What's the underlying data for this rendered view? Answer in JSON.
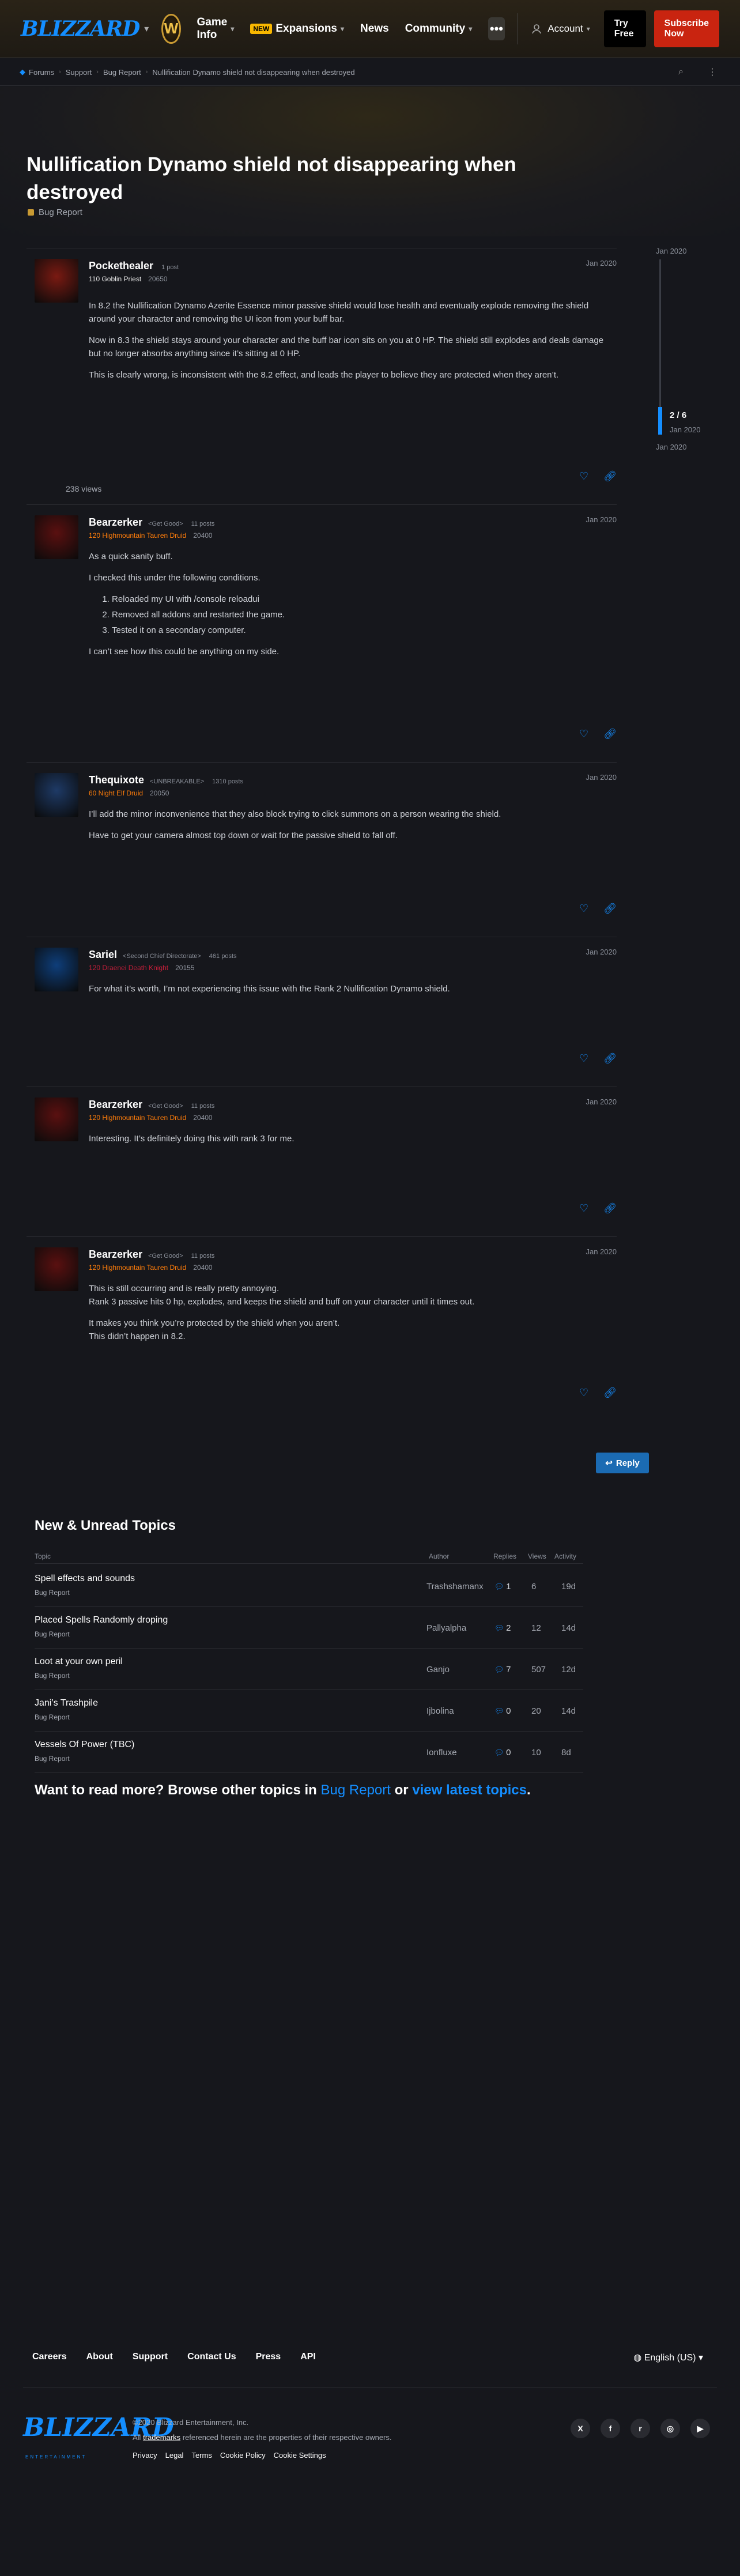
{
  "nav": {
    "logo": "BLIZZARD",
    "game_badge": "W",
    "items": [
      {
        "label": "Game Info",
        "new": ""
      },
      {
        "label": "Expansions",
        "new": "NEW"
      },
      {
        "label": "News",
        "new": ""
      },
      {
        "label": "Community",
        "new": ""
      }
    ],
    "more": "•••",
    "account": "Account",
    "try_free": "Try Free",
    "subscribe": "Subscribe Now"
  },
  "breadcrumb": [
    "Forums",
    "Support",
    "Bug Report",
    "Nullification Dynamo shield not disappearing when destroyed"
  ],
  "topic": {
    "title": "Nullification Dynamo shield not disappearing when destroyed",
    "category": "Bug Report",
    "views": "238 views"
  },
  "timeline": {
    "top_date": "Jan 2020",
    "count": "2 / 6",
    "current_date": "Jan 2020",
    "bottom_date": "Jan 2020"
  },
  "posts": [
    {
      "author": "Pockethealer",
      "title": "",
      "stat": "1 post",
      "info": "110 Goblin Priest",
      "achievement": "20650",
      "date": "Jan 2020",
      "avatar_color": "#7a1a12",
      "paragraphs": [
        "In 8.2 the Nullification Dynamo Azerite Essence minor passive shield would lose health and eventually explode removing the shield around your character and removing the UI icon from your buff bar.",
        "Now in 8.3 the shield stays around your character and the buff bar icon sits on you at 0 HP. The shield still explodes and deals damage but no longer absorbs anything since it’s sitting at 0 HP.",
        "This is clearly wrong, is inconsistent with the 8.2 effect, and leads the player to believe they are protected when they aren’t."
      ],
      "list": []
    },
    {
      "author": "Bearzerker",
      "title": "<Get Good>",
      "stat": "11 posts",
      "info": "120 Highmountain Tauren Druid",
      "achievement": "20400",
      "date": "Jan 2020",
      "avatar_color": "#5a1010",
      "paragraphs": [
        "As a quick sanity buff.",
        "I checked this under the following conditions."
      ],
      "list": [
        "Reloaded my UI with /console reloadui",
        "Removed all addons and restarted the game.",
        "Tested it on a secondary computer."
      ],
      "after": "I can’t see how this could be anything on my side."
    },
    {
      "author": "Thequixote",
      "title": "<UNBREAKABLE>",
      "stat": "1310 posts",
      "info": "60 Night Elf Druid",
      "achievement": "20050",
      "date": "Jan 2020",
      "avatar_color": "#1e3a66",
      "paragraphs": [
        "I’ll add the minor inconvenience that they also block trying to click summons on a person wearing the shield.",
        "Have to get your camera almost top down or wait for the passive shield to fall off."
      ],
      "list": []
    },
    {
      "author": "Sariel",
      "title": "<Second Chief Directorate>",
      "stat": "461 posts",
      "info": "120 Draenei Death Knight",
      "achievement": "20155",
      "date": "Jan 2020",
      "avatar_color": "#0e3e7a",
      "paragraphs": [
        "For what it’s worth, I’m not experiencing this issue with the Rank 2 Nullification Dynamo shield."
      ],
      "list": []
    },
    {
      "author": "Bearzerker",
      "title": "<Get Good>",
      "stat": "11 posts",
      "info": "120 Highmountain Tauren Druid",
      "achievement": "20400",
      "date": "Jan 2020",
      "avatar_color": "#5a1010",
      "paragraphs": [
        "Interesting. It’s definitely doing this with rank 3 for me."
      ],
      "list": []
    },
    {
      "author": "Bearzerker",
      "title": "<Get Good>",
      "stat": "11 posts",
      "info": "120 Highmountain Tauren Druid",
      "achievement": "20400",
      "date": "Jan 2020",
      "avatar_color": "#5a1010",
      "paragraphs": [
        "This is still occurring and is really pretty annoying.\nRank 3 passive hits 0 hp, explodes, and keeps the shield and buff on your character until it times out.",
        "It makes you think you’re protected by the shield when you aren’t.\nThis didn’t happen in 8.2."
      ],
      "list": []
    }
  ],
  "reply_button": "Reply",
  "new_unread": {
    "title": "New & Unread Topics",
    "headers": {
      "topic": "Topic",
      "author": "Author",
      "replies": "Replies",
      "views": "Views",
      "activity": "Activity"
    },
    "rows": [
      {
        "title": "Spell effects and sounds",
        "category": "Bug Report",
        "author": "Trashshamanx",
        "replies": "1",
        "views": "6",
        "activity": "19d"
      },
      {
        "title": "Placed Spells Randomly droping",
        "category": "Bug Report",
        "author": "Pallyalpha",
        "replies": "2",
        "views": "12",
        "activity": "14d"
      },
      {
        "title": "Loot at your own peril",
        "category": "Bug Report",
        "author": "Ganjo",
        "replies": "7",
        "views": "507",
        "activity": "12d"
      },
      {
        "title": "Jani’s Trashpile",
        "category": "Bug Report",
        "author": "Ijbolina",
        "replies": "0",
        "views": "20",
        "activity": "14d"
      },
      {
        "title": "Vessels Of Power (TBC)",
        "category": "Bug Report",
        "author": "Ionfluxe",
        "replies": "0",
        "views": "10",
        "activity": "8d"
      }
    ]
  },
  "suggest": {
    "prefix": "Want to read more? Browse other topics in",
    "category": "Bug Report",
    "or": "or",
    "link": "view latest topics",
    "suffix": "."
  },
  "footer": {
    "links": [
      "Careers",
      "About",
      "Support",
      "Contact Us",
      "Press",
      "API"
    ],
    "language": "English (US)",
    "logo": "BLIZZARD",
    "logo_sub": "ENTERTAINMENT",
    "copyright": "©2020 Blizzard Entertainment, Inc.",
    "trademark_pre": "All",
    "trademark_link": "trademarks",
    "trademark_post": "referenced herein are the properties of their respective owners.",
    "legal": [
      "Privacy",
      "Legal",
      "Terms",
      "Cookie Policy",
      "Cookie Settings"
    ],
    "social": [
      "X",
      "f",
      "r",
      "◎",
      "▶"
    ]
  }
}
